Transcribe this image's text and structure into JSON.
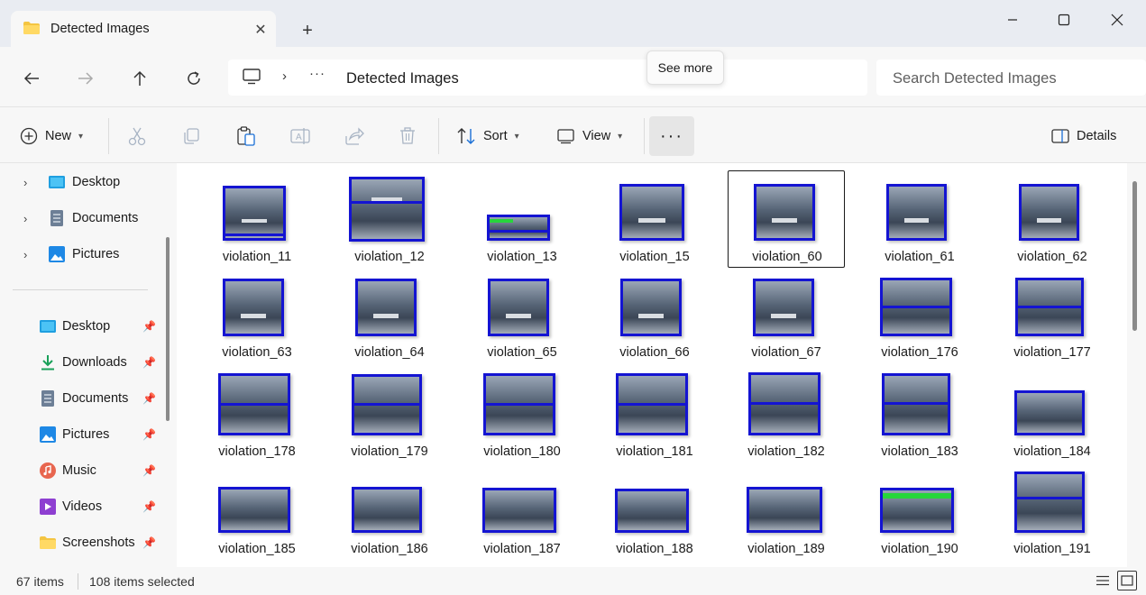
{
  "window": {
    "tab_title": "Detected Images",
    "new_tab_glyph": "+",
    "close_glyph": "✕"
  },
  "nav": {
    "breadcrumb": "Detected Images",
    "breadcrumb_sep": "›",
    "ellipsis": "···",
    "search_placeholder": "Search Detected Images",
    "tooltip": "See more"
  },
  "commands": {
    "new": "New",
    "sort": "Sort",
    "view": "View",
    "more": "···",
    "details": "Details"
  },
  "sidebar": {
    "tree": [
      {
        "label": "Desktop",
        "icon": "desktop-icon"
      },
      {
        "label": "Documents",
        "icon": "documents-icon"
      },
      {
        "label": "Pictures",
        "icon": "pictures-icon"
      }
    ],
    "quick": [
      {
        "label": "Desktop",
        "icon": "desktop-icon"
      },
      {
        "label": "Downloads",
        "icon": "downloads-icon"
      },
      {
        "label": "Documents",
        "icon": "documents-icon"
      },
      {
        "label": "Pictures",
        "icon": "pictures-icon"
      },
      {
        "label": "Music",
        "icon": "music-icon"
      },
      {
        "label": "Videos",
        "icon": "videos-icon"
      },
      {
        "label": "Screenshots",
        "icon": "folder-icon"
      }
    ]
  },
  "files": [
    "violation_11",
    "violation_12",
    "violation_13",
    "violation_15",
    "violation_60",
    "violation_61",
    "violation_62",
    "violation_63",
    "violation_64",
    "violation_65",
    "violation_66",
    "violation_67",
    "violation_176",
    "violation_177",
    "violation_178",
    "violation_179",
    "violation_180",
    "violation_181",
    "violation_182",
    "violation_183",
    "violation_184",
    "violation_185",
    "violation_186",
    "violation_187",
    "violation_188",
    "violation_189",
    "violation_190",
    "violation_191"
  ],
  "status": {
    "items": "67 items",
    "selected": "108 items selected"
  },
  "colors": {
    "selection_box": "#1414d2",
    "green_box": "#27d63b",
    "folder": "#f4c542"
  }
}
